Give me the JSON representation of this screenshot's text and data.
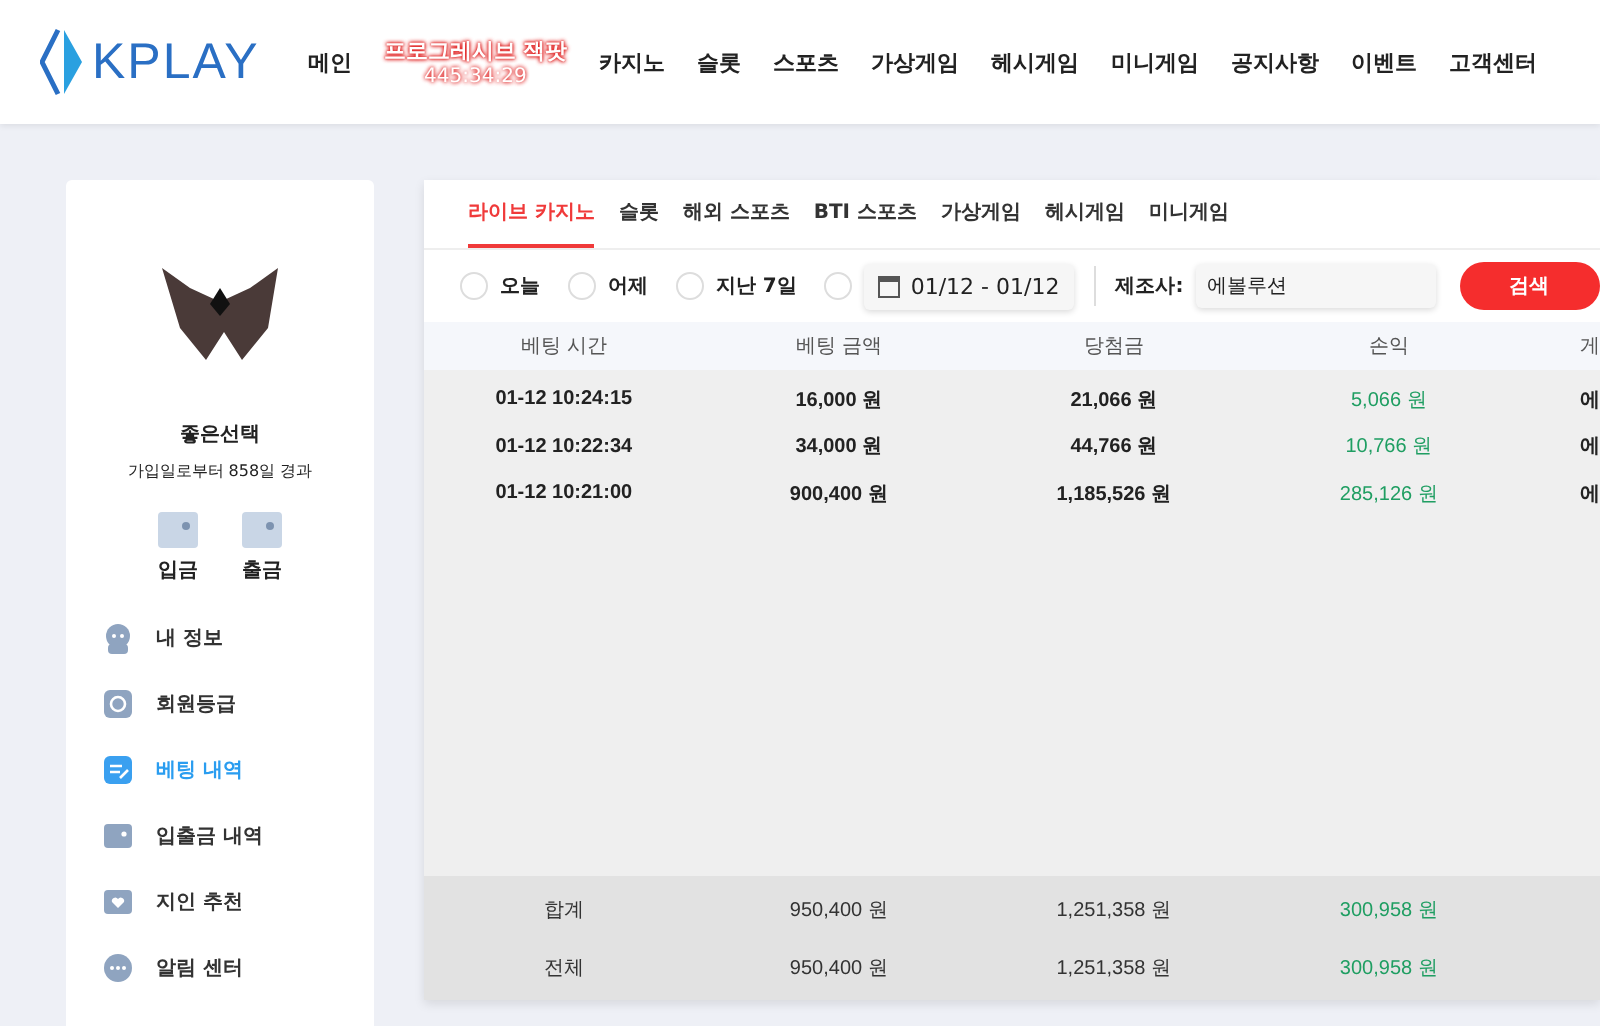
{
  "brand": {
    "name": "KPLAY"
  },
  "nav": [
    {
      "label": "메인",
      "kind": "link"
    },
    {
      "label": "프로그레시브 잭팟",
      "kind": "jackpot",
      "counter": "445:34:29"
    },
    {
      "label": "카지노",
      "kind": "link"
    },
    {
      "label": "슬롯",
      "kind": "link"
    },
    {
      "label": "스포츠",
      "kind": "link"
    },
    {
      "label": "가상게임",
      "kind": "link"
    },
    {
      "label": "헤시게임",
      "kind": "link"
    },
    {
      "label": "미니게임",
      "kind": "link"
    },
    {
      "label": "공지사항",
      "kind": "link"
    },
    {
      "label": "이벤트",
      "kind": "link"
    },
    {
      "label": "고객센터",
      "kind": "link"
    }
  ],
  "profile": {
    "name": "좋은선택",
    "since": "가입일로부터 858일 경과",
    "actions": [
      {
        "label": "입금"
      },
      {
        "label": "출금"
      }
    ]
  },
  "sidebar": {
    "items": [
      {
        "label": "내 정보",
        "selected": false
      },
      {
        "label": "회원등급",
        "selected": false
      },
      {
        "label": "베팅 내역",
        "selected": true
      },
      {
        "label": "입출금 내역",
        "selected": false
      },
      {
        "label": "지인 추천",
        "selected": false
      },
      {
        "label": "알림 센터",
        "selected": false
      }
    ]
  },
  "tabs": [
    {
      "label": "라이브 카지노",
      "selected": true
    },
    {
      "label": "슬롯",
      "selected": false
    },
    {
      "label": "해외 스포츠",
      "selected": false
    },
    {
      "label": "BTI 스포츠",
      "selected": false
    },
    {
      "label": "가상게임",
      "selected": false
    },
    {
      "label": "헤시게임",
      "selected": false
    },
    {
      "label": "미니게임",
      "selected": false
    }
  ],
  "filters": {
    "periods": [
      {
        "label": "오늘",
        "selected": false
      },
      {
        "label": "어제",
        "selected": false
      },
      {
        "label": "지난 7일",
        "selected": false
      },
      {
        "selected": false
      }
    ],
    "date_range": "01/12 - 01/12",
    "maker_label": "제조사:",
    "maker_value": "에볼루션",
    "search_button": "검색"
  },
  "table": {
    "columns": [
      "베팅 시간",
      "베팅 금액",
      "당첨금",
      "손익",
      "게"
    ],
    "rows": [
      [
        "01-12 10:24:15",
        "16,000 원",
        "21,066 원",
        "5,066 원",
        "에"
      ],
      [
        "01-12 10:22:34",
        "34,000 원",
        "44,766 원",
        "10,766 원",
        "에"
      ],
      [
        "01-12 10:21:00",
        "900,400 원",
        "1,185,526 원",
        "285,126 원",
        "에"
      ]
    ],
    "totals": [
      [
        "합계",
        "950,400 원",
        "1,251,358 원",
        "300,958 원"
      ],
      [
        "전체",
        "950,400 원",
        "1,251,358 원",
        "300,958 원"
      ]
    ]
  }
}
